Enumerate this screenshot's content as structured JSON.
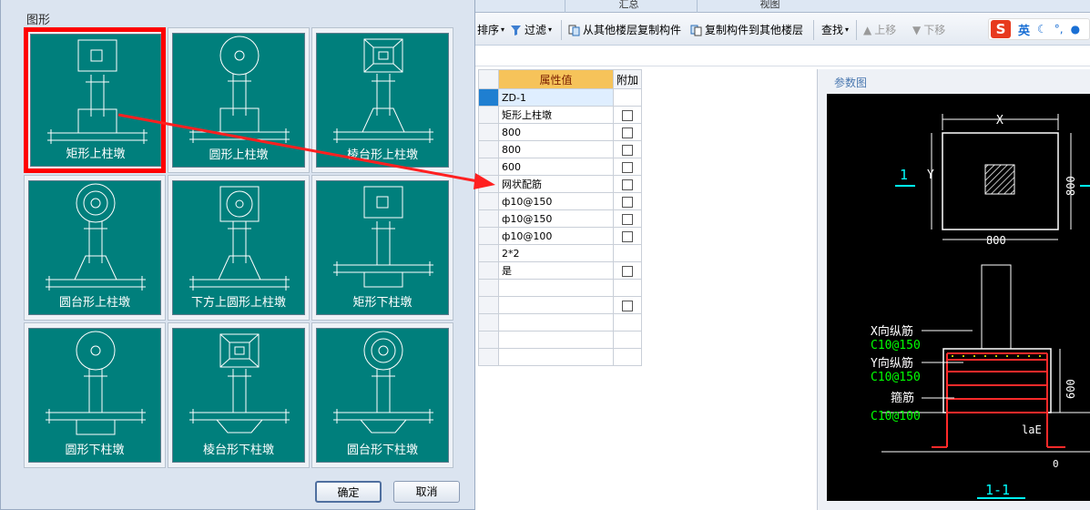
{
  "tabs": [
    "汇总",
    "视图"
  ],
  "toolbar": {
    "sort": "排序",
    "filter": "过滤",
    "copy_from": "从其他楼层复制构件",
    "copy_to": "复制构件到其他楼层",
    "find": "查找",
    "move_up": "上移",
    "move_down": "下移"
  },
  "ime": {
    "brand": "S",
    "lang": "英"
  },
  "table": {
    "header_value": "属性值",
    "header_extra": "附加",
    "rows": [
      {
        "value": "ZD-1",
        "check": false,
        "selected": true
      },
      {
        "value": "矩形上柱墩",
        "check": true
      },
      {
        "value": "800",
        "check": true
      },
      {
        "value": "800",
        "check": true
      },
      {
        "value": "600",
        "check": true
      },
      {
        "value": "网状配筋",
        "check": true
      },
      {
        "value": "ф10@150",
        "check": true
      },
      {
        "value": "ф10@150",
        "check": true
      },
      {
        "value": "ф10@100",
        "check": true
      },
      {
        "value": "2*2",
        "check": false
      },
      {
        "value": "是",
        "check": true
      },
      {
        "value": "",
        "check": false
      },
      {
        "value": "",
        "check": true
      },
      {
        "value": "",
        "check": false
      },
      {
        "value": "",
        "check": false
      },
      {
        "value": "",
        "check": false
      }
    ]
  },
  "param": {
    "title": "参数图",
    "x_label": "X",
    "y_label": "Y",
    "dim_800_bottom": "800",
    "dim_800_right": "800",
    "section_mark": "1",
    "x_rebar": "X向纵筋",
    "x_rebar_spec": "C10@150",
    "y_rebar": "Y向纵筋",
    "y_rebar_spec": "C10@150",
    "stirrup": "箍筋",
    "stirrup_spec": "C10@100",
    "dim_600": "600",
    "lae": "laE",
    "zero": "0",
    "section_label": "1-1"
  },
  "dialog": {
    "title": "图形",
    "cells": [
      {
        "label": "矩形上柱墩",
        "type": "rect-top",
        "selected": true
      },
      {
        "label": "圆形上柱墩",
        "type": "circle-top"
      },
      {
        "label": "棱台形上柱墩",
        "type": "frustum-top"
      },
      {
        "label": "圆台形上柱墩",
        "type": "cone-top"
      },
      {
        "label": "下方上圆形上柱墩",
        "type": "sqcircle-top"
      },
      {
        "label": "矩形下柱墩",
        "type": "rect-bottom"
      },
      {
        "label": "圆形下柱墩",
        "type": "circle-bottom"
      },
      {
        "label": "棱台形下柱墩",
        "type": "frustum-bottom"
      },
      {
        "label": "圆台形下柱墩",
        "type": "cone-bottom"
      }
    ],
    "ok": "确定",
    "cancel": "取消"
  },
  "colors": {
    "accent_red": "#ff0000",
    "teal": "#007f7c",
    "header_orange": "#f6c35a"
  }
}
